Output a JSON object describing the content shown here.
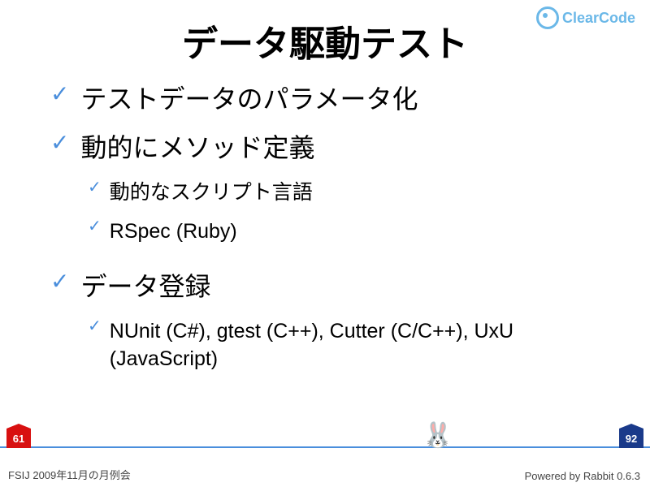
{
  "logo": {
    "text": "ClearCode"
  },
  "title": "データ駆動テスト",
  "bullets": {
    "item1": "テストデータのパラメータ化",
    "item2": "動的にメソッド定義",
    "item2_1": "動的なスクリプト言語",
    "item2_2": "RSpec (Ruby)",
    "item3": "データ登録",
    "item3_1": "NUnit (C#), gtest (C++), Cutter (C/C++), UxU (JavaScript)"
  },
  "progress": {
    "current": "61",
    "total": "92"
  },
  "footer": {
    "left": "FSIJ 2009年11月の月例会",
    "right": "Powered by Rabbit 0.6.3"
  }
}
